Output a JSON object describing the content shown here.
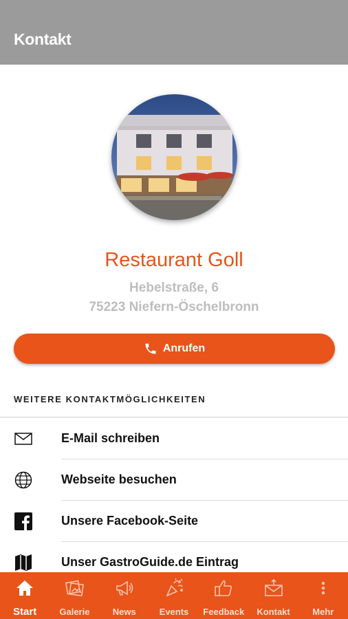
{
  "appbar": {
    "title": "Kontakt"
  },
  "restaurant": {
    "name": "Restaurant Goll",
    "street": "Hebelstraße, 6",
    "city": "75223 Niefern-Öschelbronn"
  },
  "call_button": {
    "label": "Anrufen",
    "icon": "phone-icon"
  },
  "more_contacts": {
    "title": "WEITERE KONTAKTMÖGLICHKEITEN",
    "items": [
      {
        "label": "E-Mail schreiben",
        "icon": "mail-icon"
      },
      {
        "label": "Webseite besuchen",
        "icon": "globe-icon"
      },
      {
        "label": "Unsere Facebook-Seite",
        "icon": "facebook-icon"
      },
      {
        "label": "Unser GastroGuide.de Eintrag",
        "icon": "map-icon"
      }
    ]
  },
  "bottom_nav": {
    "items": [
      {
        "label": "Start",
        "icon": "home-icon",
        "active": true
      },
      {
        "label": "Galerie",
        "icon": "gallery-icon",
        "active": false
      },
      {
        "label": "News",
        "icon": "megaphone-icon",
        "active": false
      },
      {
        "label": "Events",
        "icon": "confetti-icon",
        "active": false
      },
      {
        "label": "Feedback",
        "icon": "thumbs-up-icon",
        "active": false
      },
      {
        "label": "Kontakt",
        "icon": "envelope-icon",
        "active": false
      },
      {
        "label": "Mehr",
        "icon": "more-vertical-icon",
        "active": false
      }
    ]
  },
  "colors": {
    "accent": "#e8541a",
    "title_orange": "#e4541c",
    "appbar": "#9b9b9b",
    "address_gray": "#bdbdbd"
  }
}
